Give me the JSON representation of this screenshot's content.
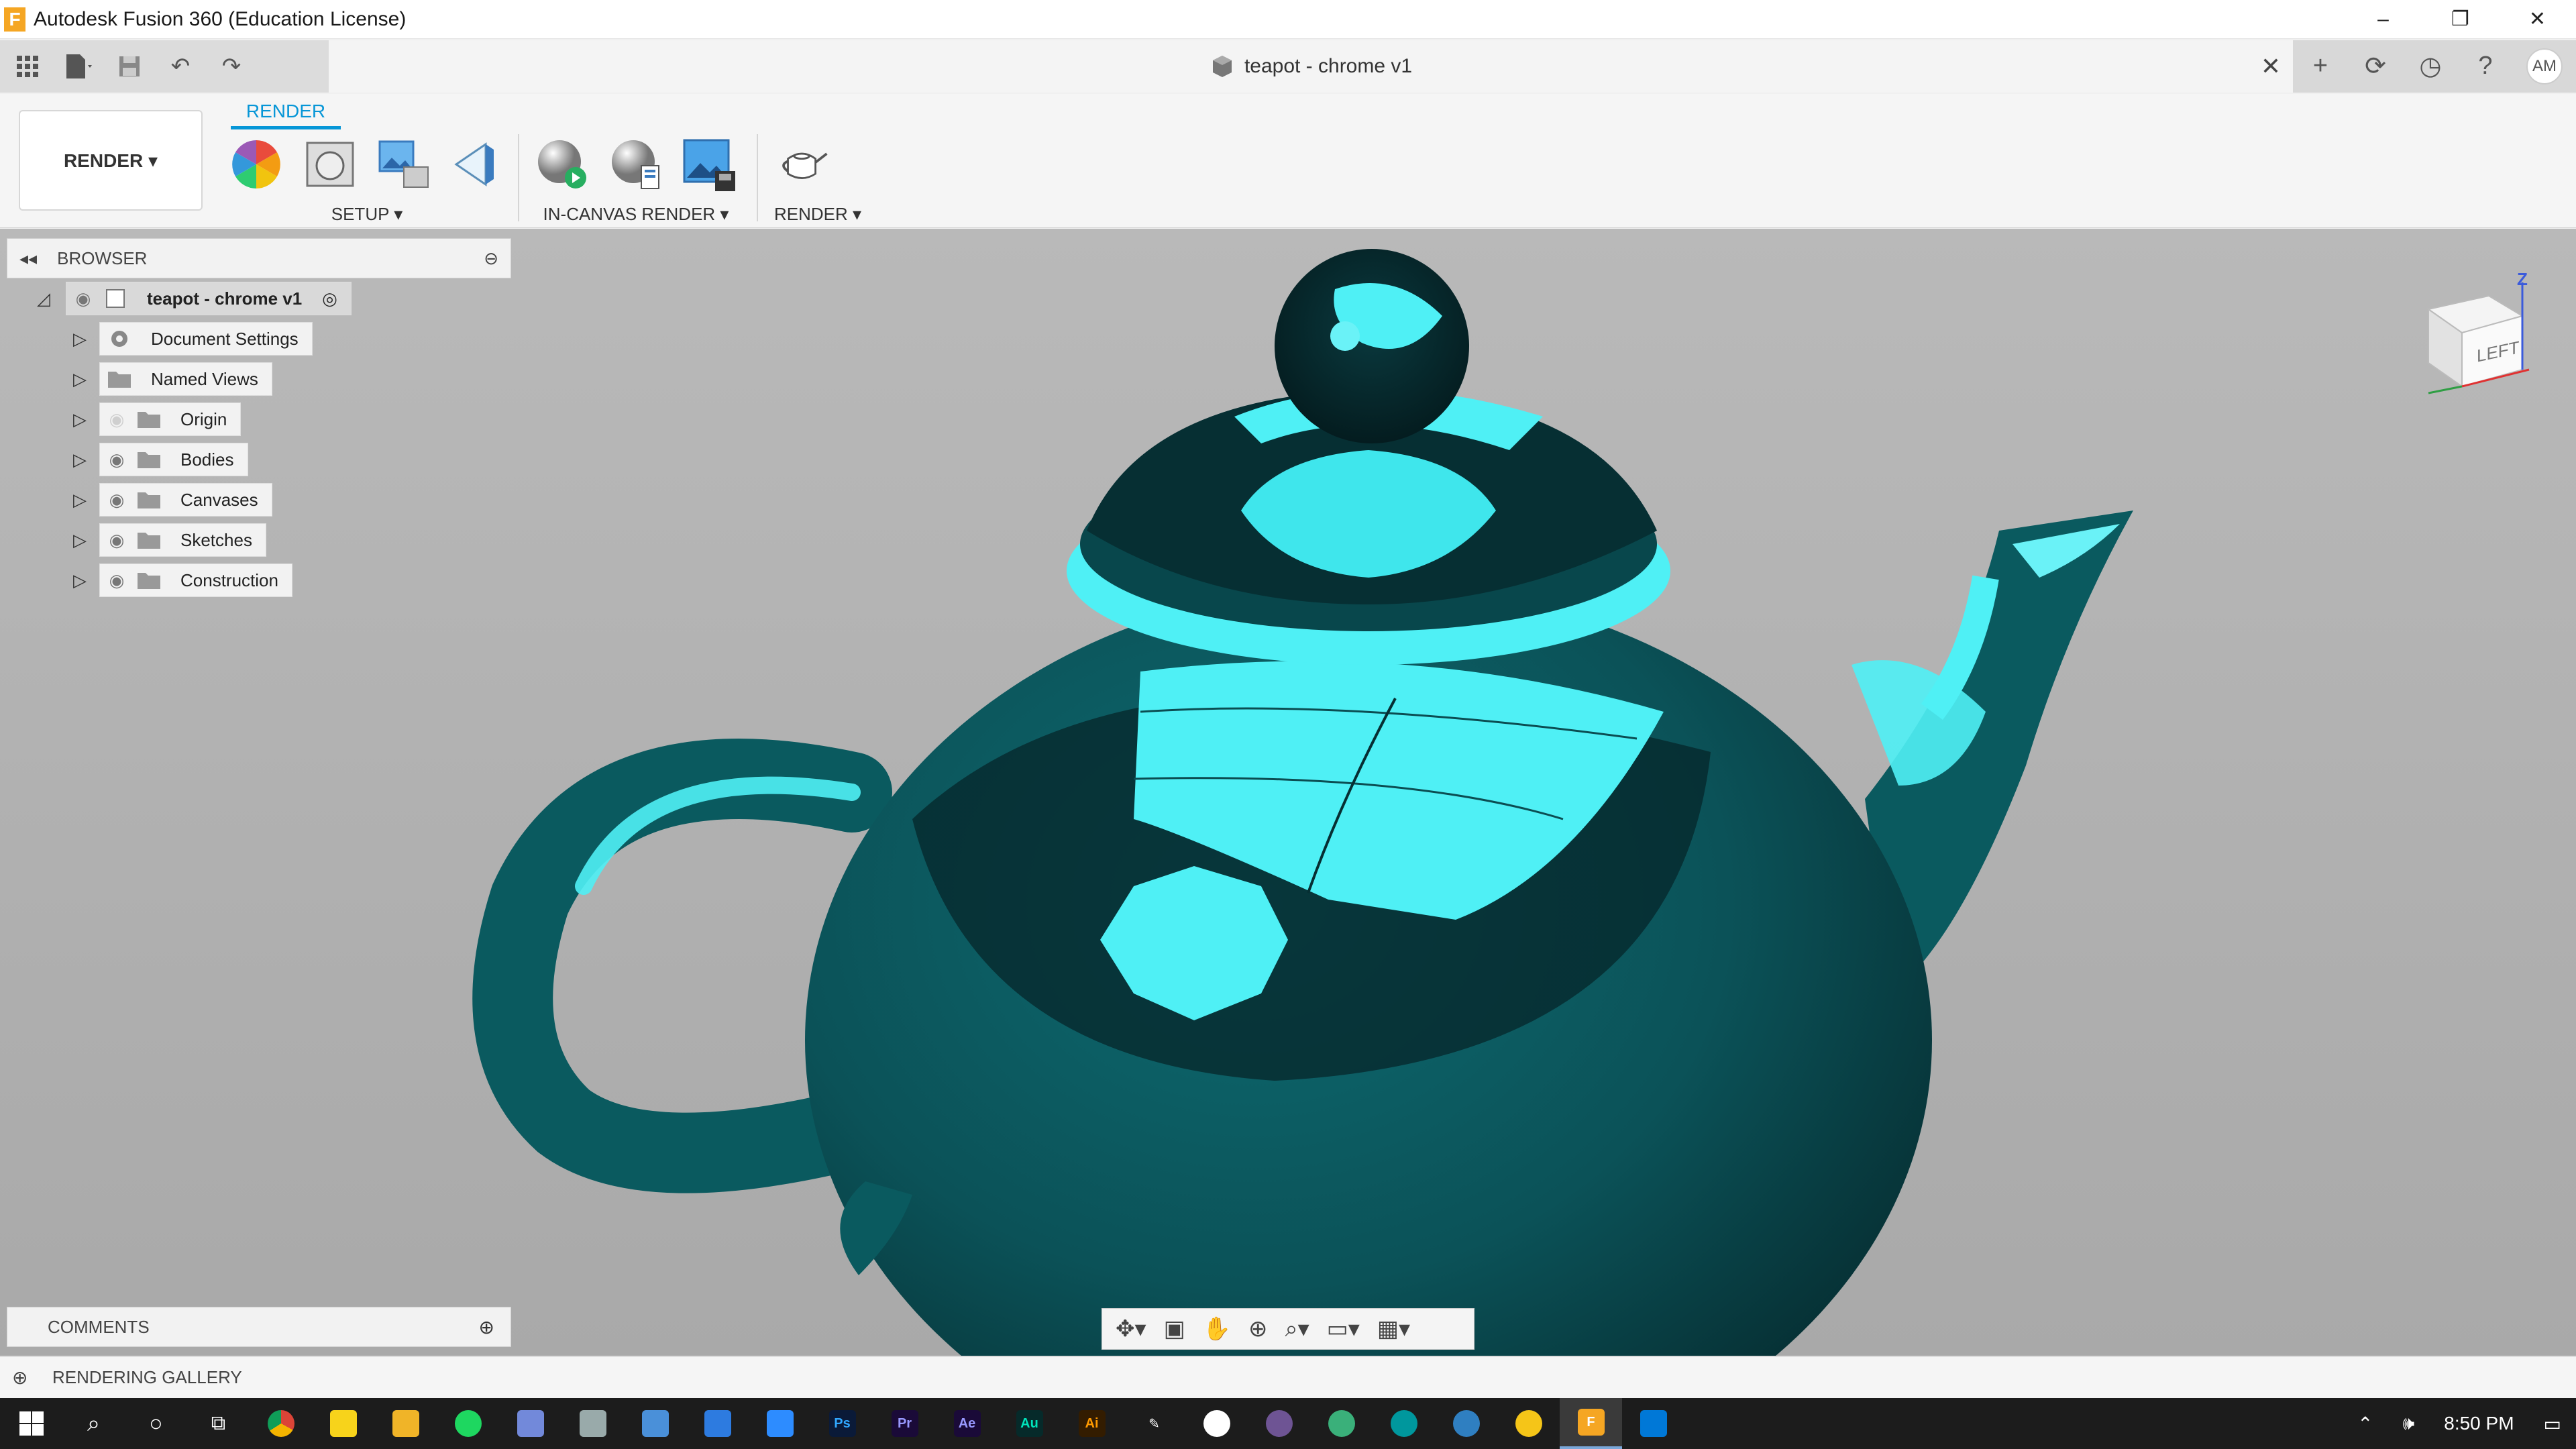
{
  "window": {
    "title": "Autodesk Fusion 360 (Education License)",
    "logo_letter": "F"
  },
  "document": {
    "tab_name": "teapot - chrome v1"
  },
  "user": {
    "initials": "AM"
  },
  "ribbon": {
    "workspace_label": "RENDER ▾",
    "active_tab": "RENDER",
    "groups": {
      "setup": "SETUP ▾",
      "in_canvas": "IN-CANVAS RENDER ▾",
      "render": "RENDER ▾"
    }
  },
  "browser": {
    "header": "BROWSER",
    "root": "teapot - chrome v1",
    "items": [
      {
        "label": "Document Settings",
        "icon": "gear-icon",
        "eye": false
      },
      {
        "label": "Named Views",
        "icon": "folder-icon",
        "eye": false
      },
      {
        "label": "Origin",
        "icon": "folder-icon",
        "eye": true,
        "hidden": true
      },
      {
        "label": "Bodies",
        "icon": "folder-icon",
        "eye": true
      },
      {
        "label": "Canvases",
        "icon": "folder-icon",
        "eye": true
      },
      {
        "label": "Sketches",
        "icon": "folder-icon",
        "eye": true
      },
      {
        "label": "Construction",
        "icon": "folder-icon",
        "eye": true
      }
    ]
  },
  "comments": {
    "header": "COMMENTS"
  },
  "gallery": {
    "header": "RENDERING GALLERY"
  },
  "viewcube": {
    "face": "LEFT",
    "axis_z": "Z"
  },
  "taskbar": {
    "time": "8:50 PM",
    "apps": [
      "Ps",
      "Pr",
      "Ae",
      "Au",
      "Ai",
      "F"
    ]
  },
  "colors": {
    "accent": "#0696d7",
    "teapot_body": "#0b5a60",
    "teapot_reflection": "#4ff0f5"
  }
}
